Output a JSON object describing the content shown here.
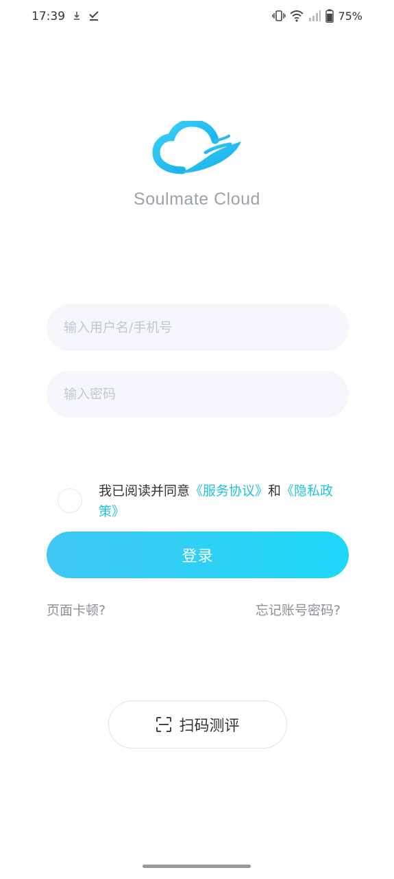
{
  "status_bar": {
    "time": "17:39",
    "battery_percent": "75%",
    "battery_level": 0.75,
    "icons": [
      "download-icon",
      "check-icon",
      "vibrate-icon",
      "wifi-icon",
      "cellular-icon",
      "battery-icon"
    ]
  },
  "brand": {
    "name": "Soulmate Cloud",
    "logo": "cloud-hand-logo",
    "color_primary": "#1fc3ef"
  },
  "login_form": {
    "username_placeholder": "输入用户名/手机号",
    "username_value": "",
    "password_placeholder": "输入密码",
    "password_value": ""
  },
  "agreement": {
    "checked": false,
    "prefix": "我已阅读并同意",
    "service_link": "《服务协议》",
    "connector": "和",
    "privacy_link": "《隐私政策》",
    "link_color": "#1fc3dc"
  },
  "login_button": {
    "label": "登录",
    "gradient_start": "#40c7f5",
    "gradient_end": "#1ed8f7"
  },
  "links": {
    "page_lag": "页面卡顿?",
    "forgot_account": "忘记账号密码?"
  },
  "scan_button": {
    "label": "扫码测评",
    "icon": "scan-icon"
  }
}
